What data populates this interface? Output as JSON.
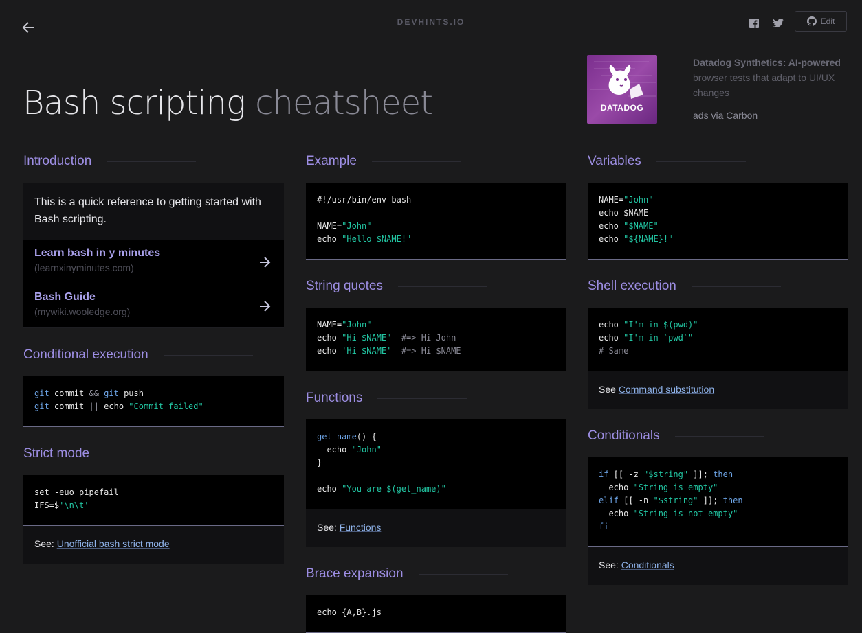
{
  "header": {
    "brand": "DEVHINTS.IO",
    "edit_label": "Edit"
  },
  "page": {
    "title_main": "Bash scripting",
    "title_sub": "cheatsheet"
  },
  "ad": {
    "image_label": "DATADOG",
    "headline": "Datadog Synthetics: AI-powered",
    "body": "browser tests that adapt to UI/UX changes",
    "via": "ads via Carbon"
  },
  "sections": {
    "introduction": {
      "title": "Introduction",
      "text": "This is a quick reference to getting started with Bash scripting.",
      "links": [
        {
          "title": "Learn bash in y minutes",
          "sub": "(learnxinyminutes.com)"
        },
        {
          "title": "Bash Guide",
          "sub": "(mywiki.wooledge.org)"
        }
      ]
    },
    "conditional_execution": {
      "title": "Conditional execution",
      "code": [
        "git",
        " commit ",
        "&&",
        " ",
        "git",
        " push",
        "git",
        " commit ",
        "||",
        " echo ",
        "\"Commit failed\""
      ]
    },
    "strict_mode": {
      "title": "Strict mode",
      "code": [
        "set -euo pipefail",
        "IFS=$",
        "'\\n\\t'"
      ],
      "see_label": "See:",
      "see_link": "Unofficial bash strict mode"
    },
    "example": {
      "title": "Example",
      "code": [
        "#!/usr/bin/env bash",
        "NAME=",
        "\"John\"",
        "echo ",
        "\"Hello $NAME!\""
      ]
    },
    "string_quotes": {
      "title": "String quotes",
      "code": [
        "NAME=",
        "\"John\"",
        "echo ",
        "\"Hi $NAME\"",
        "  #=> Hi John",
        "echo ",
        "'Hi $NAME'",
        "  #=> Hi $NAME"
      ]
    },
    "functions": {
      "title": "Functions",
      "code": [
        "get_name",
        "() {",
        "  echo ",
        "\"John\"",
        "}",
        "echo ",
        "\"You are $(get_name)\""
      ],
      "see_label": "See:",
      "see_link": "Functions"
    },
    "brace_expansion": {
      "title": "Brace expansion",
      "code": [
        "echo {A,B}.js"
      ]
    },
    "variables": {
      "title": "Variables",
      "code": [
        "NAME=",
        "\"John\"",
        "echo $NAME",
        "echo ",
        "\"$NAME\"",
        "echo ",
        "\"${NAME}!\""
      ]
    },
    "shell_execution": {
      "title": "Shell execution",
      "code": [
        "echo ",
        "\"I'm in $(pwd)\"",
        "echo ",
        "\"I'm in `pwd`\"",
        "# Same"
      ],
      "see_label": "See",
      "see_link": "Command substitution"
    },
    "conditionals": {
      "title": "Conditionals",
      "code": [
        "if",
        " [[ -z ",
        "\"$string\"",
        " ]]; ",
        "then",
        "  echo ",
        "\"String is empty\"",
        "elif",
        " [[ -n ",
        "\"$string\"",
        " ]]; ",
        "then",
        "  echo ",
        "\"String is not empty\"",
        "fi"
      ],
      "see_label": "See:",
      "see_link": "Conditionals"
    }
  },
  "colors": {
    "background": "#1b1b1c",
    "heading": "#9d8ee3",
    "string": "#22c6a3",
    "keyword": "#6da4e6",
    "link": "#8fb3ea"
  },
  "icons": [
    "back-arrow-icon",
    "facebook-icon",
    "twitter-icon",
    "github-icon",
    "arrow-right-icon"
  ]
}
